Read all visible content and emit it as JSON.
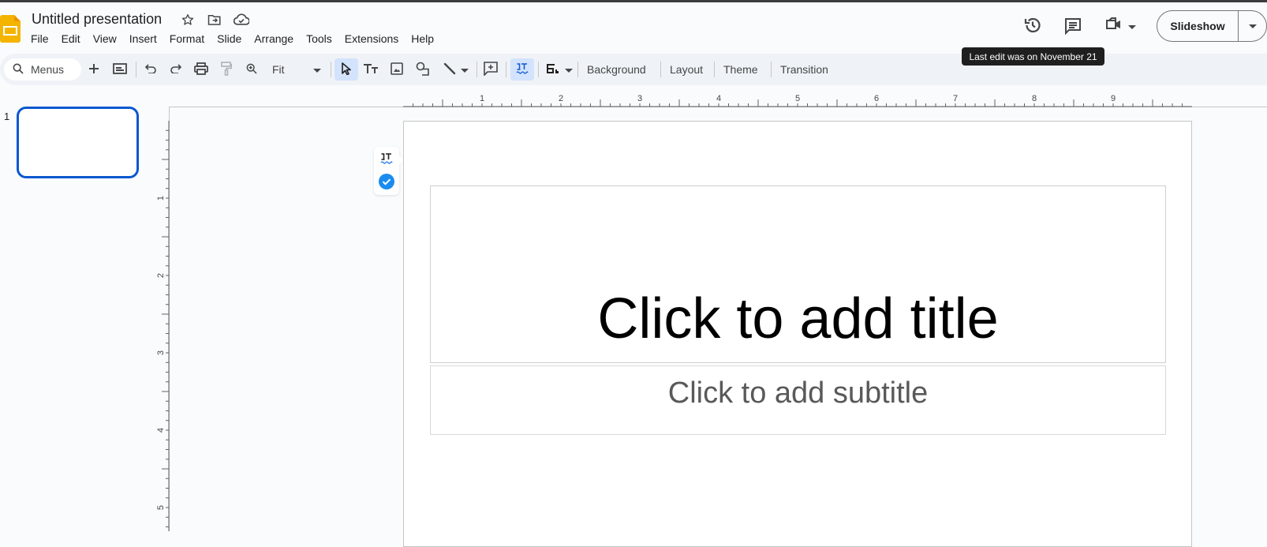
{
  "app": {
    "title": "Untitled presentation",
    "brand_color": "#F4B400",
    "accent_color": "#0B57D0"
  },
  "title_icons": [
    "star-icon",
    "move-to-folder-icon",
    "cloud-saved-icon"
  ],
  "menubar": {
    "items": [
      "File",
      "Edit",
      "View",
      "Insert",
      "Format",
      "Slide",
      "Arrange",
      "Tools",
      "Extensions",
      "Help"
    ]
  },
  "header_right": {
    "icons": [
      "version-history-icon",
      "comments-icon",
      "meet-video-icon"
    ],
    "slideshow_label": "Slideshow",
    "tooltip": "Last edit was on November 21"
  },
  "toolbar": {
    "search_placeholder": "Menus",
    "zoom_value": "Fit",
    "buttons": [
      "new-slide",
      "layout-dropdown",
      "undo",
      "redo",
      "print",
      "paint-format",
      "zoom",
      "select",
      "text-box",
      "image",
      "shape",
      "line",
      "comment",
      "spell-check",
      "placeholder"
    ],
    "text_buttons": {
      "background": "Background",
      "layout": "Layout",
      "theme": "Theme",
      "transition": "Transition"
    }
  },
  "rulers": {
    "horizontal_labels": [
      "1",
      "2",
      "3",
      "4",
      "5",
      "6",
      "7",
      "8",
      "9"
    ],
    "vertical_labels": [
      "1",
      "2",
      "3",
      "4",
      "5"
    ]
  },
  "filmstrip": {
    "slides": [
      {
        "number": "1",
        "selected": true
      }
    ]
  },
  "slide": {
    "title_placeholder": "Click to add title",
    "subtitle_placeholder": "Click to add subtitle"
  },
  "float_panel": {
    "icons": [
      "spell-check-icon",
      "check-circle-icon"
    ]
  }
}
